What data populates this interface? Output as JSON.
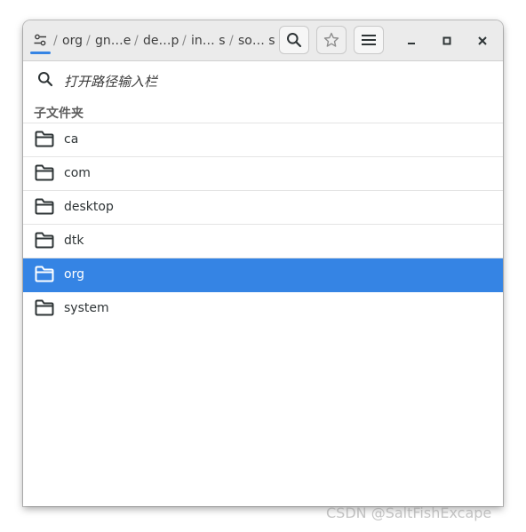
{
  "window": {
    "path": [
      "org",
      "gn…e",
      "de…p",
      "in… s",
      "so… s"
    ],
    "path_separator": "/"
  },
  "header_buttons": {
    "search_icon": "search-icon",
    "bookmark_icon": "star-icon",
    "menu_icon": "hamburger-menu-icon"
  },
  "window_controls": [
    "minimize-icon",
    "maximize-icon",
    "close-icon"
  ],
  "search": {
    "placeholder": "打开路径输入栏"
  },
  "section": {
    "title": "子文件夹"
  },
  "folders": [
    {
      "label": "ca",
      "selected": false
    },
    {
      "label": "com",
      "selected": false
    },
    {
      "label": "desktop",
      "selected": false
    },
    {
      "label": "dtk",
      "selected": false
    },
    {
      "label": "org",
      "selected": true
    },
    {
      "label": "system",
      "selected": false
    }
  ],
  "colors": {
    "accent": "#3584e4",
    "headerbar": "#ebebeb"
  },
  "watermark": "CSDN @SaltFishExcape"
}
